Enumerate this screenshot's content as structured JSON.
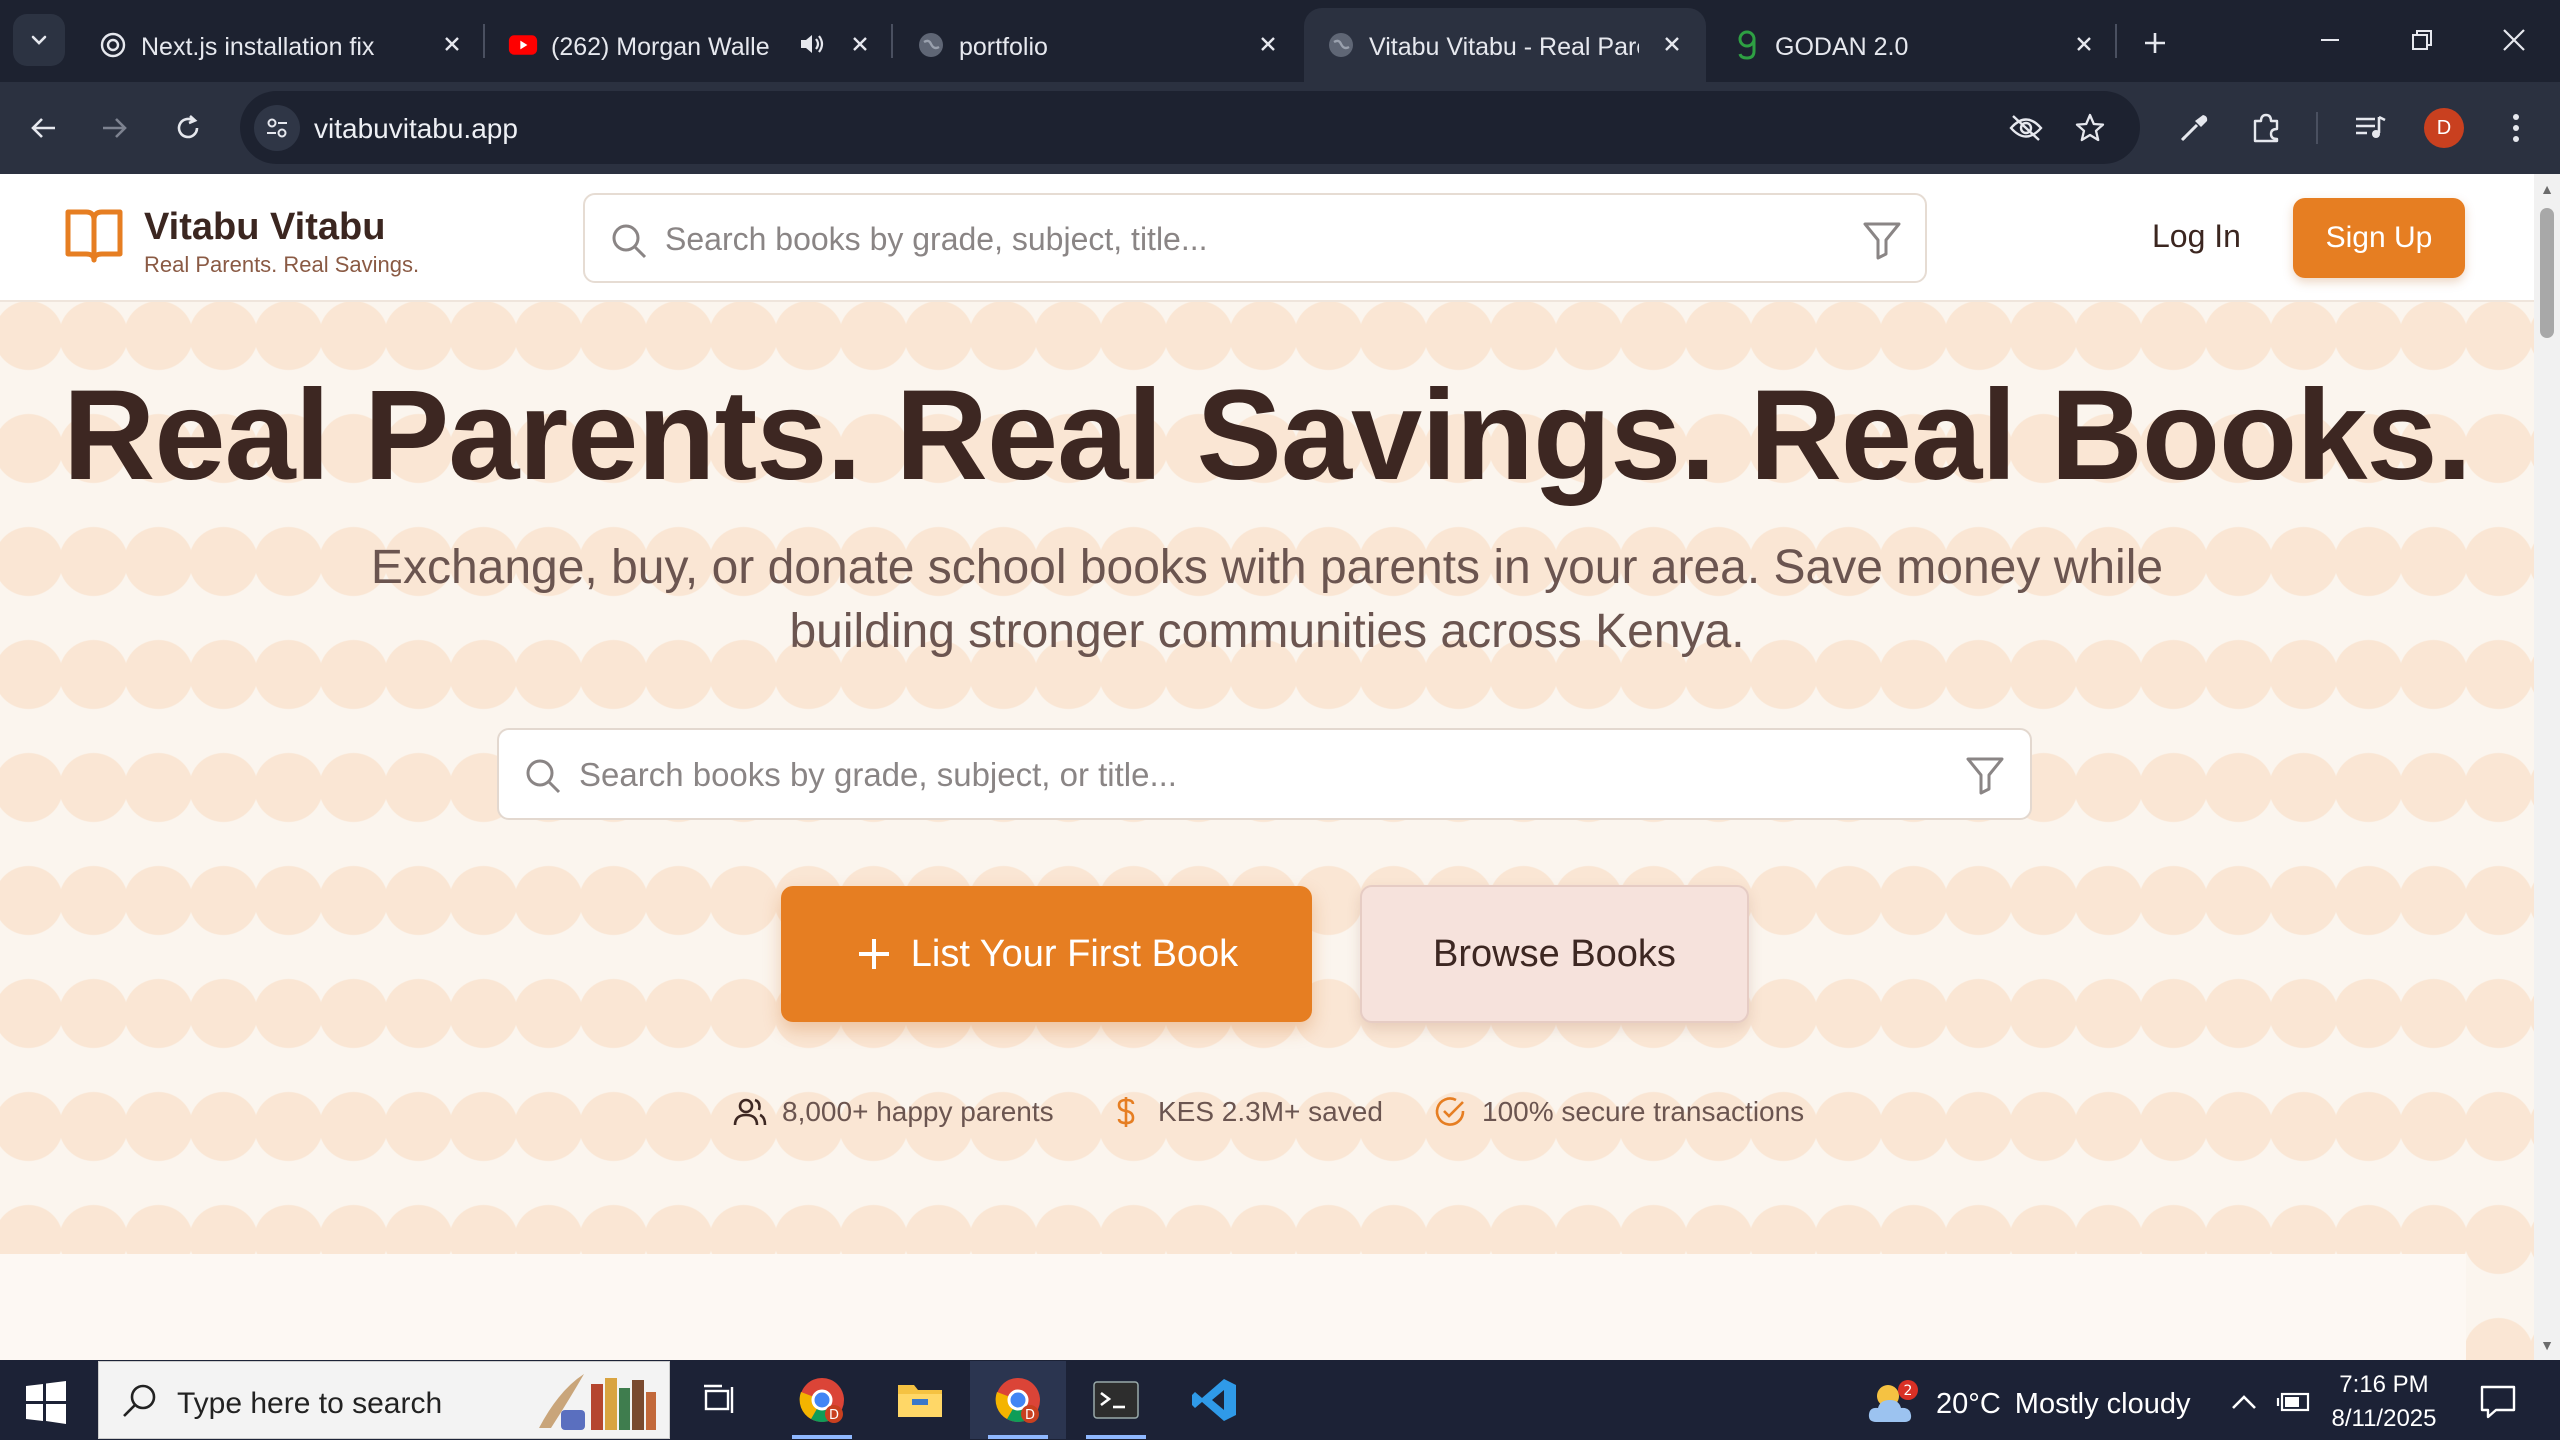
{
  "browser": {
    "tabs": [
      {
        "title": "Next.js installation fix",
        "favicon": "openai-icon",
        "active": false
      },
      {
        "title": "(262) Morgan Wallen",
        "favicon": "youtube-icon",
        "active": false,
        "audio": true
      },
      {
        "title": "portfolio",
        "favicon": "globe-icon",
        "active": false
      },
      {
        "title": "Vitabu Vitabu - Real Pare",
        "favicon": "globe-icon",
        "active": true
      },
      {
        "title": "GODAN 2.0",
        "favicon": "godan-icon",
        "active": false
      }
    ],
    "url": "vitabuvitabu.app",
    "profile_initial": "D"
  },
  "site": {
    "brand_name": "Vitabu Vitabu",
    "brand_tagline": "Real Parents. Real Savings.",
    "header_search_placeholder": "Search books by grade, subject, title...",
    "login_label": "Log In",
    "signup_label": "Sign Up",
    "hero": {
      "title": "Real Parents. Real Savings. Real Books.",
      "subtitle": "Exchange, buy, or donate school books with parents in your area. Save money while building stronger communities across Kenya.",
      "search_placeholder": "Search books by grade, subject, or title...",
      "primary_cta": "List Your First Book",
      "secondary_cta": "Browse Books"
    },
    "stats": [
      {
        "icon": "users-icon",
        "text": "8,000+ happy parents"
      },
      {
        "icon": "dollar-icon",
        "text": "KES 2.3M+ saved"
      },
      {
        "icon": "check-circle-icon",
        "text": "100% secure transactions"
      }
    ],
    "colors": {
      "accent": "#e67e22",
      "heading": "#3d2722",
      "secondary_button": "#f6e2dc"
    }
  },
  "taskbar": {
    "search_placeholder": "Type here to search",
    "weather": {
      "temp": "20°C",
      "condition": "Mostly cloudy",
      "badge": "2"
    },
    "time": "7:16 PM",
    "date": "8/11/2025"
  }
}
